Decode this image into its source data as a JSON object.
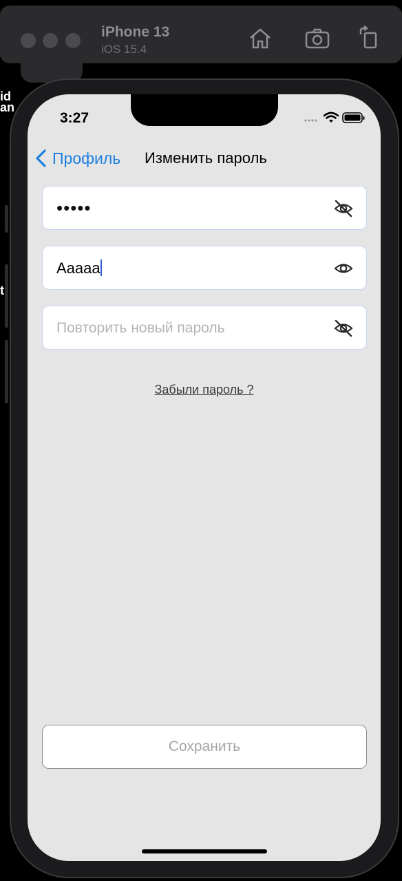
{
  "simulator": {
    "device_name": "iPhone 13",
    "os_version": "iOS 15.4",
    "toolbar_icons": [
      "home-icon",
      "screenshot-icon",
      "rotate-icon"
    ]
  },
  "background_fragments": [
    "id",
    "an",
    "t"
  ],
  "status_bar": {
    "time": "3:27",
    "icons": [
      "signal-icon",
      "wifi-icon",
      "battery-icon"
    ]
  },
  "nav": {
    "back_label": "Профиль",
    "title": "Изменить пароль"
  },
  "form": {
    "current_password": {
      "masked_value": "•••••",
      "visibility_icon": "eye-off-icon"
    },
    "new_password": {
      "value": "Aaaaa",
      "visibility_icon": "eye-icon"
    },
    "repeat_password": {
      "placeholder": "Повторить новый пароль",
      "visibility_icon": "eye-off-icon"
    },
    "forgot_link": "Забыли пароль ?",
    "save_label": "Сохранить"
  },
  "colors": {
    "accent": "#1d7fe0",
    "screen_bg": "#e5e5e6",
    "field_border": "#c9d6f2",
    "disabled_text": "#a5a5aa"
  }
}
